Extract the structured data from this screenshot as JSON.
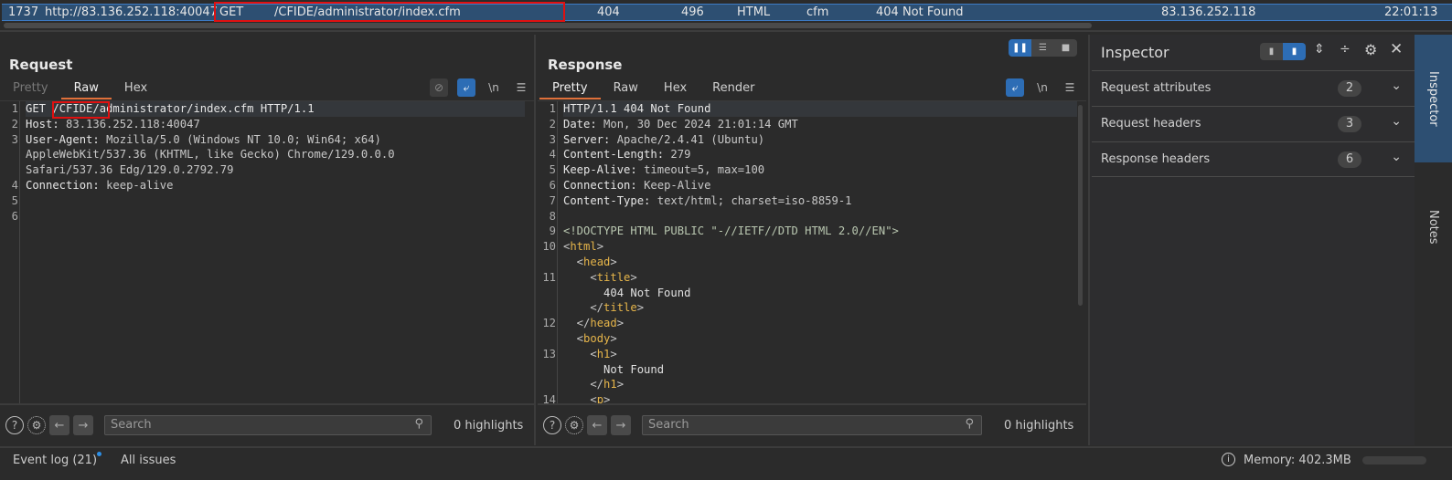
{
  "history_row": {
    "id": "1737",
    "host": "http://83.136.252.118:40047",
    "method": "GET",
    "url": "/CFIDE/administrator/index.cfm",
    "status": "404",
    "length": "496",
    "mime": "HTML",
    "ext": "cfm",
    "title": "404 Not Found",
    "ip": "83.136.252.118",
    "time": "22:01:13"
  },
  "request": {
    "title": "Request",
    "tabs": [
      "Pretty",
      "Raw",
      "Hex"
    ],
    "active_tab": "Raw",
    "lines": [
      {
        "n": "1",
        "segs": [
          [
            "GET ",
            "k"
          ],
          [
            "/CFIDE/",
            "k"
          ],
          [
            "administrator/index.cfm HTTP/1.1",
            "k"
          ]
        ]
      },
      {
        "n": "2",
        "segs": [
          [
            "Host: ",
            "k"
          ],
          [
            "83.136.252.118:40047",
            "v"
          ]
        ]
      },
      {
        "n": "3",
        "segs": [
          [
            "User-Agent: ",
            "k"
          ],
          [
            "Mozilla/5.0 (Windows NT 10.0; Win64; x64)",
            "v"
          ]
        ]
      },
      {
        "n": "",
        "segs": [
          [
            "AppleWebKit/537.36 (KHTML, like Gecko) Chrome/129.0.0.0",
            "v"
          ]
        ]
      },
      {
        "n": "",
        "segs": [
          [
            "Safari/537.36 Edg/129.0.2792.79",
            "v"
          ]
        ]
      },
      {
        "n": "4",
        "segs": [
          [
            "Connection: ",
            "k"
          ],
          [
            "keep-alive",
            "v"
          ]
        ]
      },
      {
        "n": "5",
        "segs": []
      },
      {
        "n": "6",
        "segs": []
      }
    ],
    "search_placeholder": "Search",
    "highlights": "0 highlights"
  },
  "response": {
    "title": "Response",
    "tabs": [
      "Pretty",
      "Raw",
      "Hex",
      "Render"
    ],
    "active_tab": "Pretty",
    "lines": [
      {
        "n": "1",
        "segs": [
          [
            "HTTP/1.1 404 Not Found",
            "k"
          ]
        ]
      },
      {
        "n": "2",
        "segs": [
          [
            "Date: ",
            "k"
          ],
          [
            "Mon, 30 Dec 2024 21:01:14 GMT",
            "v"
          ]
        ]
      },
      {
        "n": "3",
        "segs": [
          [
            "Server: ",
            "k"
          ],
          [
            "Apache/2.4.41 (Ubuntu)",
            "v"
          ]
        ]
      },
      {
        "n": "4",
        "segs": [
          [
            "Content-Length: ",
            "k"
          ],
          [
            "279",
            "v"
          ]
        ]
      },
      {
        "n": "5",
        "segs": [
          [
            "Keep-Alive: ",
            "k"
          ],
          [
            "timeout=5, max=100",
            "v"
          ]
        ]
      },
      {
        "n": "6",
        "segs": [
          [
            "Connection: ",
            "k"
          ],
          [
            "Keep-Alive",
            "v"
          ]
        ]
      },
      {
        "n": "7",
        "segs": [
          [
            "Content-Type: ",
            "k"
          ],
          [
            "text/html; charset=iso-8859-1",
            "v"
          ]
        ]
      },
      {
        "n": "8",
        "segs": []
      },
      {
        "n": "9",
        "segs": [
          [
            "<!DOCTYPE HTML PUBLIC \"-//IETF//DTD HTML 2.0//EN\">",
            "d"
          ]
        ]
      },
      {
        "n": "10",
        "segs": [
          [
            "<",
            "p"
          ],
          [
            "html",
            "t"
          ],
          [
            ">",
            "p"
          ]
        ]
      },
      {
        "n": "",
        "segs": [
          [
            "  <",
            "p"
          ],
          [
            "head",
            "t"
          ],
          [
            ">",
            "p"
          ]
        ]
      },
      {
        "n": "11",
        "segs": [
          [
            "    <",
            "p"
          ],
          [
            "title",
            "t"
          ],
          [
            ">",
            "p"
          ]
        ]
      },
      {
        "n": "",
        "segs": [
          [
            "      404 Not Found",
            "x"
          ]
        ]
      },
      {
        "n": "",
        "segs": [
          [
            "    </",
            "p"
          ],
          [
            "title",
            "t"
          ],
          [
            ">",
            "p"
          ]
        ]
      },
      {
        "n": "12",
        "segs": [
          [
            "  </",
            "p"
          ],
          [
            "head",
            "t"
          ],
          [
            ">",
            "p"
          ]
        ]
      },
      {
        "n": "",
        "segs": [
          [
            "  <",
            "p"
          ],
          [
            "body",
            "t"
          ],
          [
            ">",
            "p"
          ]
        ]
      },
      {
        "n": "13",
        "segs": [
          [
            "    <",
            "p"
          ],
          [
            "h1",
            "t"
          ],
          [
            ">",
            "p"
          ]
        ]
      },
      {
        "n": "",
        "segs": [
          [
            "      Not Found",
            "x"
          ]
        ]
      },
      {
        "n": "",
        "segs": [
          [
            "    </",
            "p"
          ],
          [
            "h1",
            "t"
          ],
          [
            ">",
            "p"
          ]
        ]
      },
      {
        "n": "14",
        "segs": [
          [
            "    <",
            "p"
          ],
          [
            "p",
            "t"
          ],
          [
            ">",
            "p"
          ]
        ]
      }
    ],
    "search_placeholder": "Search",
    "highlights": "0 highlights"
  },
  "inspector": {
    "title": "Inspector",
    "sections": [
      {
        "label": "Request attributes",
        "count": "2"
      },
      {
        "label": "Request headers",
        "count": "3"
      },
      {
        "label": "Response headers",
        "count": "6"
      }
    ]
  },
  "side_tabs": [
    "Inspector",
    "Notes"
  ],
  "status": {
    "event_log": "Event log (21)",
    "all_issues": "All issues",
    "memory": "Memory: 402.3MB"
  },
  "colors": {
    "accent": "#2d6db5",
    "row_selected": "#2d4f72",
    "highlight_box": "#e01010",
    "tab_underline": "#e0703a"
  }
}
